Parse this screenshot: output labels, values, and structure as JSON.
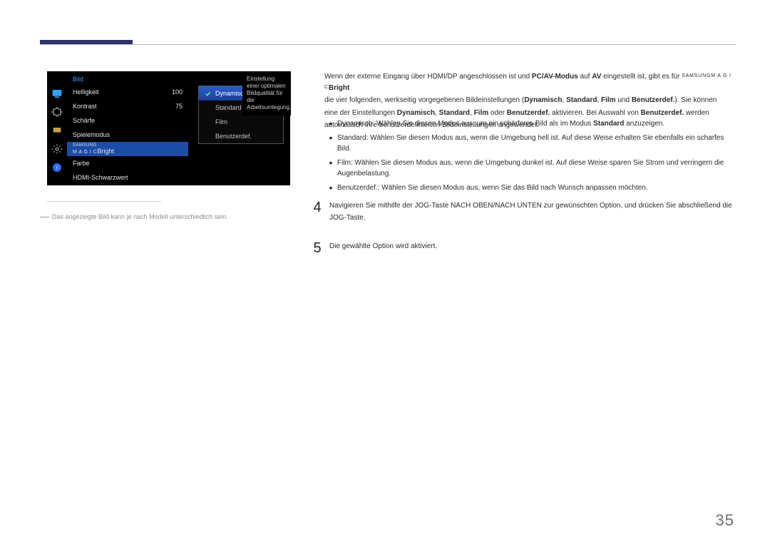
{
  "osd": {
    "title": "Bild",
    "items": [
      {
        "label": "Helligkeit",
        "value": "100"
      },
      {
        "label": "Kontrast",
        "value": "75"
      },
      {
        "label": "Schärfe",
        "value": ""
      },
      {
        "label": "Spielemodus",
        "value": ""
      },
      {
        "label_prefix": "SAMSUNG",
        "label_magic": "M A G I C",
        "label_suffix": "Bright",
        "value": ""
      },
      {
        "label": "Farbe",
        "value": ""
      },
      {
        "label": "HDMI-Schwarzwert",
        "value": ""
      }
    ],
    "sub": [
      {
        "label": "Dynamisch",
        "selected": true
      },
      {
        "label": "Standard"
      },
      {
        "label": "Film"
      },
      {
        "label": "Benutzerdef."
      }
    ],
    "help": "Einstellung einer optimalen Bildqualität für die Arbeitsumlegung.",
    "note_dash": "―",
    "note": "Das angezeigte Bild kann je nach Modell unterschiedlich sein."
  },
  "para": {
    "p1a": "Wenn der externe Eingang über HDMI/DP angeschlossen ist und ",
    "p1b": "PC/AV-Modus",
    "p1c": " auf ",
    "p1d": "AV",
    "p1e": " eingestellt ist, gibt es für ",
    "p1f_tiny": "SAMSUNG",
    "p1f_magic": "M A G I C",
    "p1g": "Bright",
    "p2a": "die vier folgenden, werkseitig vorgegebenen Bildeinstellungen (",
    "p2b": "Dynamisch",
    "p2c": ", ",
    "p2d": "Standard",
    "p2e": ", ",
    "p2f": "Film",
    "p2g": " und ",
    "p2h": "Benutzerdef.",
    "p2i": "). Sie können",
    "p3a": "eine der Einstellungen ",
    "p3b": "Dynamisch",
    "p3c": ", ",
    "p3d": "Standard",
    "p3e": ", ",
    "p3f": "Film",
    "p3g": " oder ",
    "p3h": "Benutzerdef.",
    "p3i": " aktivieren. Bei Auswahl von ",
    "p3j": "Benutzerdef.",
    "p3k": " werden",
    "p4": "automatisch Ihre benutzerdefinierten Bildeinstellungen angewendet."
  },
  "bullets": {
    "dot": "•",
    "b1a": "Dynamisch",
    "b1b": ": Wählen Sie diesen Modus aus, um ein schärferes Bild als im Modus ",
    "b1c": "Standard",
    "b1d": " anzuzeigen.",
    "b2a": "Standard",
    "b2b": ": Wählen Sie diesen Modus aus, wenn die Umgebung hell ist. Auf diese Weise erhalten Sie ebenfalls ein scharfes Bild.",
    "b3a": "Film",
    "b3b": ": Wählen Sie diesen Modus aus, wenn die Umgebung dunkel ist. Auf diese Weise sparen Sie Strom und verringern die Augenbelastung.",
    "b4a": "Benutzerdef.",
    "b4b": ": Wählen Sie diesen Modus aus, wenn Sie das Bild nach Wunsch anpassen möchten."
  },
  "steps": {
    "n4": "4",
    "t4": "Navigieren Sie mithilfe der JOG-Taste NACH OBEN/NACH UNTEN zur gewünschten Option, und drücken Sie abschließend die JOG-Taste.",
    "n5": "5",
    "t5": "Die gewählte Option wird aktiviert."
  },
  "pagenum": "35"
}
